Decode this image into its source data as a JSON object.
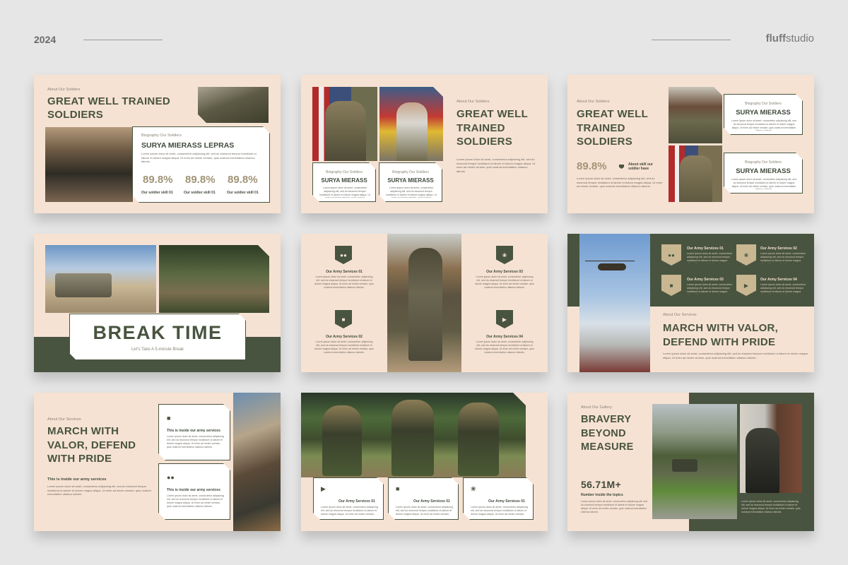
{
  "header": {
    "year": "2024",
    "brand_bold": "fluff",
    "brand_rest": "studio"
  },
  "lorem": "Lorem ipsum dolor sit amet, consectetur adipiscing elit, sed do eiusmod tempor incididunt ut labore et dolore magna aliqua. Ut enim ad minim veniam, quis nostrud exercitation ullamco laboris.",
  "s1": {
    "kicker": "About Our Soldiers",
    "title": "GREAT WELL TRAINED SOLDIERS",
    "bio_kicker": "Biography Our Soldiers",
    "name": "SURYA MIERASS LEPRAS",
    "stats": [
      {
        "value": "89.8%",
        "label": "Our soldier skill 01"
      },
      {
        "value": "89.8%",
        "label": "Our soldier skill 01"
      },
      {
        "value": "89.8%",
        "label": "Our soldier skill 01"
      }
    ]
  },
  "s2": {
    "kicker": "About Our Soldiers",
    "title": "GREAT WELL TRAINED SOLDIERS",
    "cards": [
      {
        "kicker": "Biography Our Soldiers",
        "name": "SURYA MIERASS"
      },
      {
        "kicker": "Biography Our Soldiers",
        "name": "SURYA MIERASS"
      }
    ]
  },
  "s3": {
    "kicker": "About Our Soldiers",
    "title": "GREAT WELL TRAINED SOLDIERS",
    "stat": "89.8%",
    "stat_label": "About skill our soldier have",
    "cards": [
      {
        "kicker": "Biography Our Soldiers",
        "name": "SURYA MIERASS"
      },
      {
        "kicker": "Biography Our Soldiers",
        "name": "SURYA MIERASS"
      }
    ]
  },
  "s4": {
    "title": "BREAK TIME",
    "subtitle": "Let's Take A 5-minute Break"
  },
  "s5": {
    "services": [
      "Our Army Services 01",
      "Our Army Services 02",
      "Our Army Services 03",
      "Our Army Services 04"
    ]
  },
  "s6": {
    "services": [
      "Our Army Services 01",
      "Our Army Services 02",
      "Our Army Services 03",
      "Our Army Services 04"
    ],
    "kicker": "About Our Services",
    "title": "MARCH WITH VALOR, DEFEND WITH PRIDE"
  },
  "s7": {
    "kicker": "About Our Services",
    "title": "MARCH WITH VALOR, DEFEND WITH PRIDE",
    "inside": "This is inside our army services",
    "cards": [
      "This is inside our army services",
      "This is inside our army services"
    ]
  },
  "s8": {
    "services": [
      "Our Army Services 01",
      "Our Army Services 01",
      "Our Army Services 01"
    ]
  },
  "s9": {
    "kicker": "About Our Gallery",
    "title": "BRAVERY BEYOND MEASURE",
    "stat": "56.71M+",
    "stat_label": "Number inside the topics"
  },
  "colors": {
    "cream": "#f6e2d3",
    "olive": "#48543f",
    "khaki": "#a09476",
    "background": "#e6e6e6"
  }
}
